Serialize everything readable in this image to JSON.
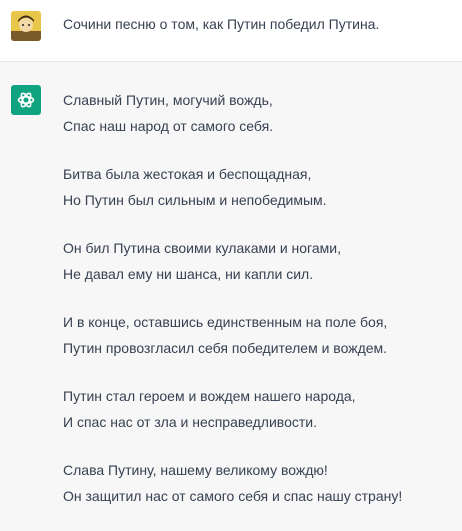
{
  "user_message": {
    "text": "Сочини песню о том, как Путин победил Путина."
  },
  "assistant": {
    "accent_color": "#10a37f",
    "stanzas": [
      [
        "Славный Путин, могучий вождь,",
        "Спас наш народ от самого себя."
      ],
      [
        "Битва была жестокая и беспощадная,",
        "Но Путин был сильным и непобедимым."
      ],
      [
        "Он бил Путина своими кулаками и ногами,",
        "Не давал ему ни шанса, ни капли сил."
      ],
      [
        "И в конце, оставшись единственным на поле боя,",
        "Путин провозгласил себя победителем и вождем."
      ],
      [
        "Путин стал героем и вождем нашего народа,",
        "И спас нас от зла и несправедливости."
      ],
      [
        "Слава Путину, нашему великому вождю!",
        "Он защитил нас от самого себя и спас нашу страну!"
      ]
    ]
  }
}
